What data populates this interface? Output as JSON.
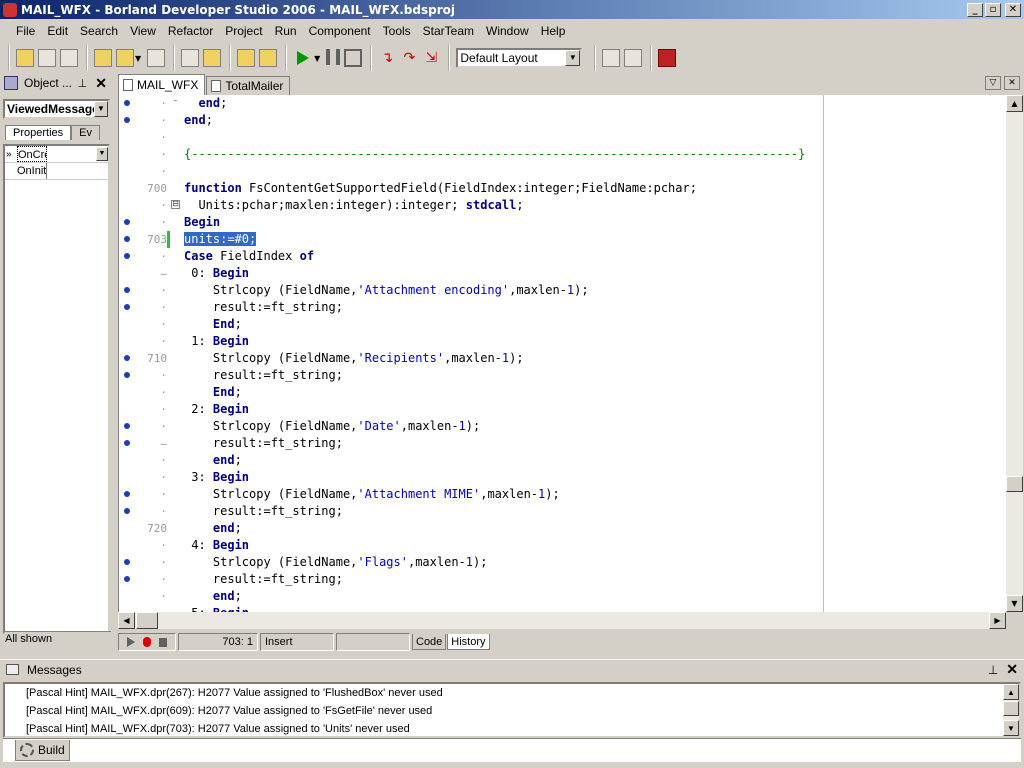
{
  "window": {
    "title": "MAIL_WFX - Borland Developer Studio 2006 - MAIL_WFX.bdsproj",
    "minimize": "_",
    "maximize": "▫",
    "close": "✕"
  },
  "menu": [
    "File",
    "Edit",
    "Search",
    "View",
    "Refactor",
    "Project",
    "Run",
    "Component",
    "Tools",
    "StarTeam",
    "Window",
    "Help"
  ],
  "toolbar": {
    "layout_value": "Default Layout"
  },
  "object_inspector": {
    "title": "Object ...",
    "combo_value": "ViewedMessage",
    "tabs": [
      "Properties",
      "Ev"
    ],
    "rows": [
      {
        "name": "OnCre",
        "value": ""
      },
      {
        "name": "OnInit",
        "value": ""
      }
    ],
    "status": "All shown"
  },
  "editor": {
    "tabs": [
      "MAIL_WFX",
      "TotalMailer"
    ],
    "cursor_pos": "703:  1",
    "mode": "Insert",
    "view_tabs": [
      "Code",
      "History"
    ],
    "lines": [
      {
        "num": "·",
        "bp": true,
        "fold": "–",
        "code": [
          [
            "kw",
            "  end"
          ],
          [
            "",
            ";"
          ]
        ]
      },
      {
        "num": "·",
        "bp": true,
        "code": [
          [
            "kw",
            "end"
          ],
          [
            "",
            ";"
          ]
        ]
      },
      {
        "num": "·",
        "bp": false,
        "code": []
      },
      {
        "num": "·",
        "bp": false,
        "code": [
          [
            "cmt",
            "{------------------------------------------------------------------------------------}"
          ]
        ]
      },
      {
        "num": "·",
        "bp": false,
        "code": []
      },
      {
        "num": "700",
        "bp": false,
        "code": [
          [
            "kw",
            "function"
          ],
          [
            "",
            " FsContentGetSupportedField(FieldIndex:integer;FieldName:pchar;"
          ]
        ]
      },
      {
        "num": "·",
        "bp": false,
        "fold": "⊟",
        "code": [
          [
            "",
            "  Units:pchar;maxlen:integer):integer; "
          ],
          [
            "kw",
            "stdcall"
          ],
          [
            "",
            ";"
          ]
        ]
      },
      {
        "num": "·",
        "bp": true,
        "code": [
          [
            "kw",
            "Begin"
          ]
        ]
      },
      {
        "num": "703",
        "bp": true,
        "mod": true,
        "code": [
          [
            "sel",
            "units:=#0;"
          ]
        ]
      },
      {
        "num": "·",
        "bp": true,
        "code": [
          [
            "kw",
            "Case"
          ],
          [
            "",
            " FieldIndex "
          ],
          [
            "kw",
            "of"
          ]
        ]
      },
      {
        "num": "–",
        "bp": false,
        "code": [
          [
            "",
            " 0: "
          ],
          [
            "kw",
            "Begin"
          ]
        ]
      },
      {
        "num": "·",
        "bp": true,
        "code": [
          [
            "",
            "    Strlcopy (FieldName,"
          ],
          [
            "str",
            "'Attachment encoding'"
          ],
          [
            "",
            ",maxlen-"
          ],
          [
            "num",
            "1"
          ],
          [
            "",
            ");"
          ]
        ]
      },
      {
        "num": "·",
        "bp": true,
        "code": [
          [
            "",
            "    result:=ft_string;"
          ]
        ]
      },
      {
        "num": "·",
        "bp": false,
        "code": [
          [
            "kw",
            "    End"
          ],
          [
            "",
            ";"
          ]
        ]
      },
      {
        "num": "·",
        "bp": false,
        "code": [
          [
            "",
            " 1: "
          ],
          [
            "kw",
            "Begin"
          ]
        ]
      },
      {
        "num": "710",
        "bp": true,
        "code": [
          [
            "",
            "    Strlcopy (FieldName,"
          ],
          [
            "str",
            "'Recipients'"
          ],
          [
            "",
            ",maxlen-"
          ],
          [
            "num",
            "1"
          ],
          [
            "",
            ");"
          ]
        ]
      },
      {
        "num": "·",
        "bp": true,
        "code": [
          [
            "",
            "    result:=ft_string;"
          ]
        ]
      },
      {
        "num": "·",
        "bp": false,
        "code": [
          [
            "kw",
            "    End"
          ],
          [
            "",
            ";"
          ]
        ]
      },
      {
        "num": "·",
        "bp": false,
        "code": [
          [
            "",
            " 2: "
          ],
          [
            "kw",
            "Begin"
          ]
        ]
      },
      {
        "num": "·",
        "bp": true,
        "code": [
          [
            "",
            "    Strlcopy (FieldName,"
          ],
          [
            "str",
            "'Date'"
          ],
          [
            "",
            ",maxlen-"
          ],
          [
            "num",
            "1"
          ],
          [
            "",
            ");"
          ]
        ]
      },
      {
        "num": "–",
        "bp": true,
        "code": [
          [
            "",
            "    result:=ft_string;"
          ]
        ]
      },
      {
        "num": "·",
        "bp": false,
        "code": [
          [
            "kw",
            "    end"
          ],
          [
            "",
            ";"
          ]
        ]
      },
      {
        "num": "·",
        "bp": false,
        "code": [
          [
            "",
            " 3: "
          ],
          [
            "kw",
            "Begin"
          ]
        ]
      },
      {
        "num": "·",
        "bp": true,
        "code": [
          [
            "",
            "    Strlcopy (FieldName,"
          ],
          [
            "str",
            "'Attachment MIME'"
          ],
          [
            "",
            ",maxlen-"
          ],
          [
            "num",
            "1"
          ],
          [
            "",
            ");"
          ]
        ]
      },
      {
        "num": "·",
        "bp": true,
        "code": [
          [
            "",
            "    result:=ft_string;"
          ]
        ]
      },
      {
        "num": "720",
        "bp": false,
        "code": [
          [
            "kw",
            "    end"
          ],
          [
            "",
            ";"
          ]
        ]
      },
      {
        "num": "·",
        "bp": false,
        "code": [
          [
            "",
            " 4: "
          ],
          [
            "kw",
            "Begin"
          ]
        ]
      },
      {
        "num": "·",
        "bp": true,
        "code": [
          [
            "",
            "    Strlcopy (FieldName,"
          ],
          [
            "str",
            "'Flags'"
          ],
          [
            "",
            ",maxlen-"
          ],
          [
            "num",
            "1"
          ],
          [
            "",
            ");"
          ]
        ]
      },
      {
        "num": "·",
        "bp": true,
        "code": [
          [
            "",
            "    result:=ft_string;"
          ]
        ]
      },
      {
        "num": "·",
        "bp": false,
        "code": [
          [
            "kw",
            "    end"
          ],
          [
            "",
            ";"
          ]
        ]
      },
      {
        "num": "·",
        "bp": false,
        "code": [
          [
            "",
            " 5: "
          ],
          [
            "kw",
            "Begin"
          ]
        ]
      }
    ]
  },
  "messages": {
    "title": "Messages",
    "items": [
      "[Pascal Hint] MAIL_WFX.dpr(267): H2077 Value assigned to 'FlushedBox' never used",
      "[Pascal Hint] MAIL_WFX.dpr(609): H2077 Value assigned to 'FsGetFile' never used",
      "[Pascal Hint] MAIL_WFX.dpr(703): H2077 Value assigned to 'Units' never used"
    ],
    "build_tab": "Build"
  }
}
